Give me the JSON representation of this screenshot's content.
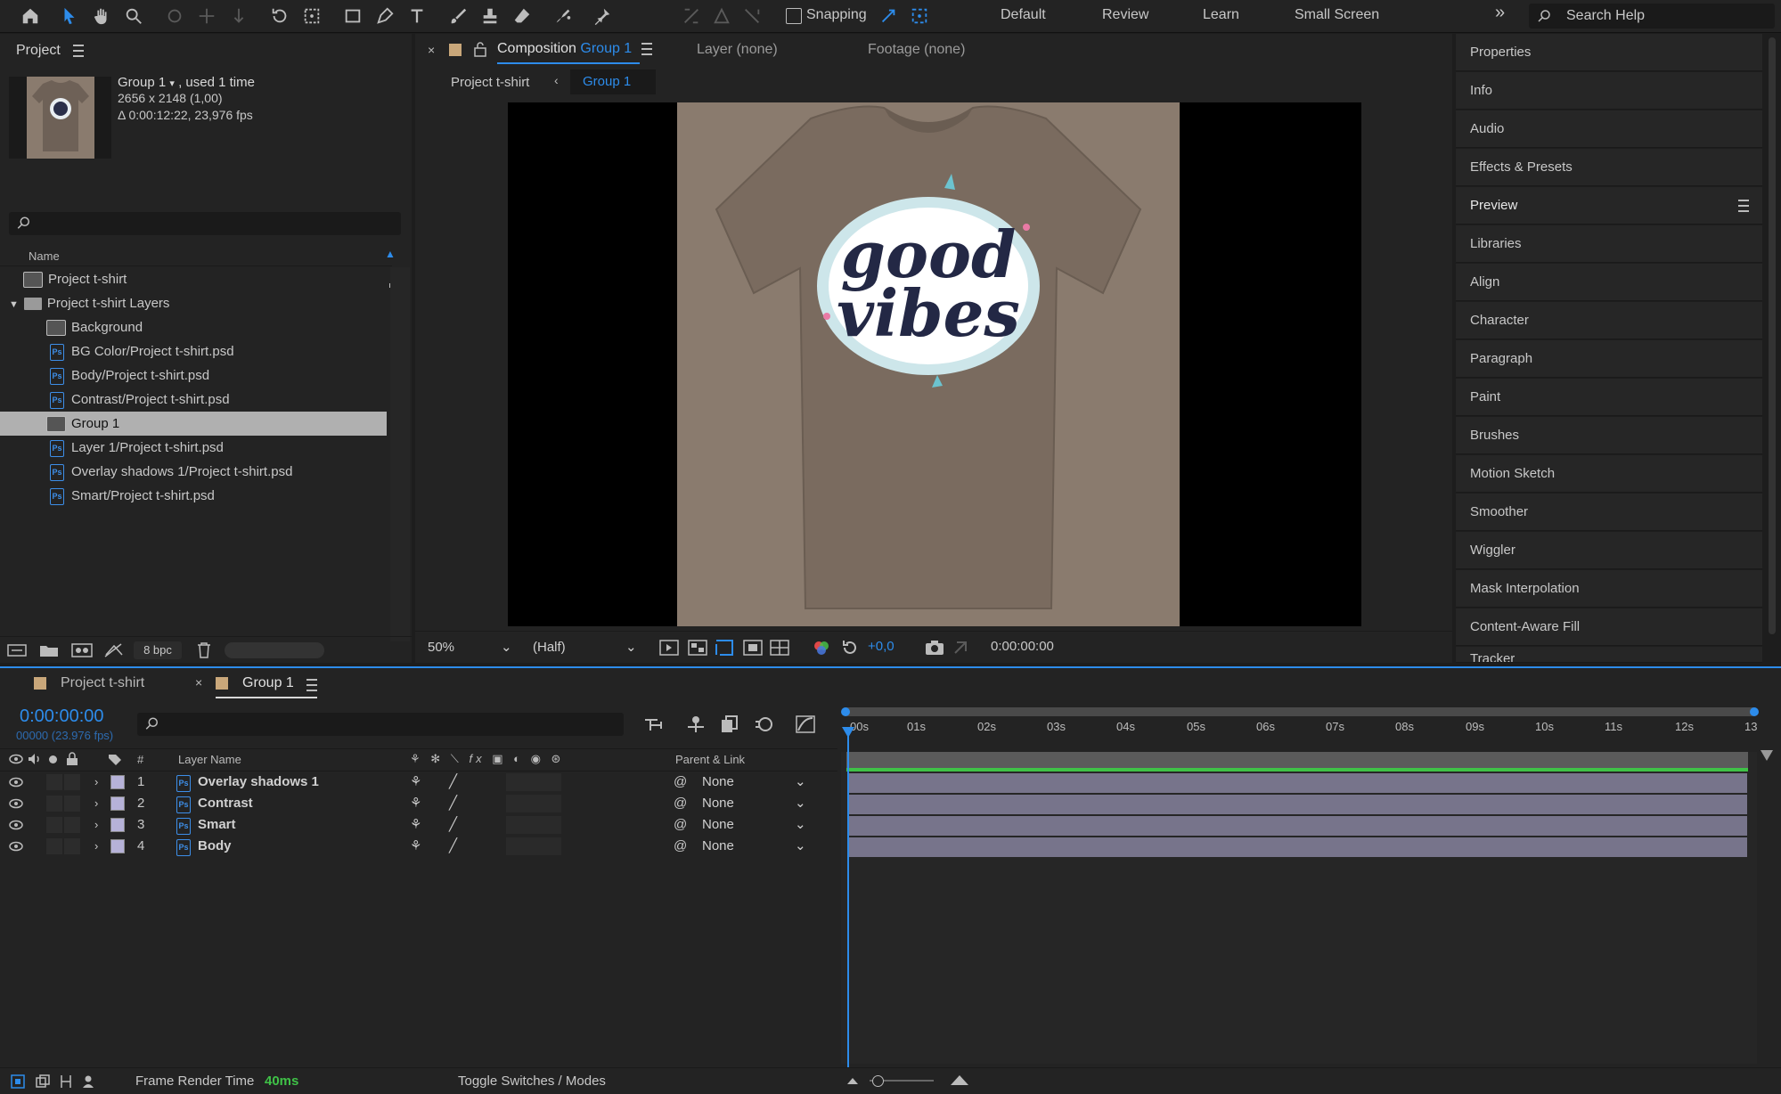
{
  "toolbar": {
    "snapping_label": "Snapping",
    "workspaces": [
      "Default",
      "Review",
      "Learn",
      "Small Screen"
    ],
    "more_icon": "»",
    "search_placeholder": "Search Help"
  },
  "project_panel": {
    "title": "Project",
    "item_name": "Group 1",
    "item_usage": ", used 1 time",
    "item_dims": "2656 x 2148 (1,00)",
    "item_duration": "Δ 0:00:12:22, 23,976 fps",
    "column_name": "Name",
    "items": [
      {
        "label": "Project t-shirt",
        "type": "comp",
        "indent": 0
      },
      {
        "label": "Project t-shirt Layers",
        "type": "folder",
        "indent": 0
      },
      {
        "label": "Background",
        "type": "comp",
        "indent": 1
      },
      {
        "label": "BG Color/Project t-shirt.psd",
        "type": "psd",
        "indent": 1
      },
      {
        "label": "Body/Project t-shirt.psd",
        "type": "psd",
        "indent": 1
      },
      {
        "label": "Contrast/Project t-shirt.psd",
        "type": "psd",
        "indent": 1
      },
      {
        "label": "Group 1",
        "type": "comp",
        "indent": 1,
        "selected": true
      },
      {
        "label": "Layer 1/Project t-shirt.psd",
        "type": "psd",
        "indent": 1
      },
      {
        "label": "Overlay shadows 1/Project t-shirt.psd",
        "type": "psd",
        "indent": 1
      },
      {
        "label": "Smart/Project t-shirt.psd",
        "type": "psd",
        "indent": 1
      }
    ],
    "bpc_label": "8 bpc"
  },
  "composition_panel": {
    "tab_prefix": "Composition",
    "tab_name": "Group 1",
    "layer_tab": "Layer (none)",
    "footage_tab": "Footage (none)",
    "breadcrumb_parent": "Project t-shirt",
    "breadcrumb_current": "Group 1",
    "zoom": "50%",
    "resolution": "(Half)",
    "exposure": "+0,0",
    "timecode": "0:00:00:00",
    "artwork_line1": "good",
    "artwork_line2": "vibes"
  },
  "right_panel": {
    "items": [
      "Properties",
      "Info",
      "Audio",
      "Effects & Presets",
      "Preview",
      "Libraries",
      "Align",
      "Character",
      "Paragraph",
      "Paint",
      "Brushes",
      "Motion Sketch",
      "Smoother",
      "Wiggler",
      "Mask Interpolation",
      "Content-Aware Fill",
      "Tracker"
    ]
  },
  "timeline": {
    "tab1": "Project t-shirt",
    "tab2": "Group 1",
    "timecode": "0:00:00:00",
    "frame_info": "00000 (23.976 fps)",
    "col_hash": "#",
    "col_layer_name": "Layer Name",
    "col_parent": "Parent & Link",
    "layers": [
      {
        "num": "1",
        "name": "Overlay shadows 1",
        "parent": "None"
      },
      {
        "num": "2",
        "name": "Contrast",
        "parent": "None"
      },
      {
        "num": "3",
        "name": "Smart",
        "parent": "None"
      },
      {
        "num": "4",
        "name": "Body",
        "parent": "None"
      }
    ],
    "ruler": [
      "00s",
      "01s",
      "02s",
      "03s",
      "04s",
      "05s",
      "06s",
      "07s",
      "08s",
      "09s",
      "10s",
      "11s",
      "12s",
      "13"
    ],
    "render_label": "Frame Render Time",
    "render_value": "40ms",
    "toggle_label": "Toggle Switches / Modes"
  },
  "colors": {
    "accent": "#2d8ceb",
    "bar": "#77748b",
    "selection": "#b0b0b0",
    "shirt": "#8a7b6e"
  }
}
